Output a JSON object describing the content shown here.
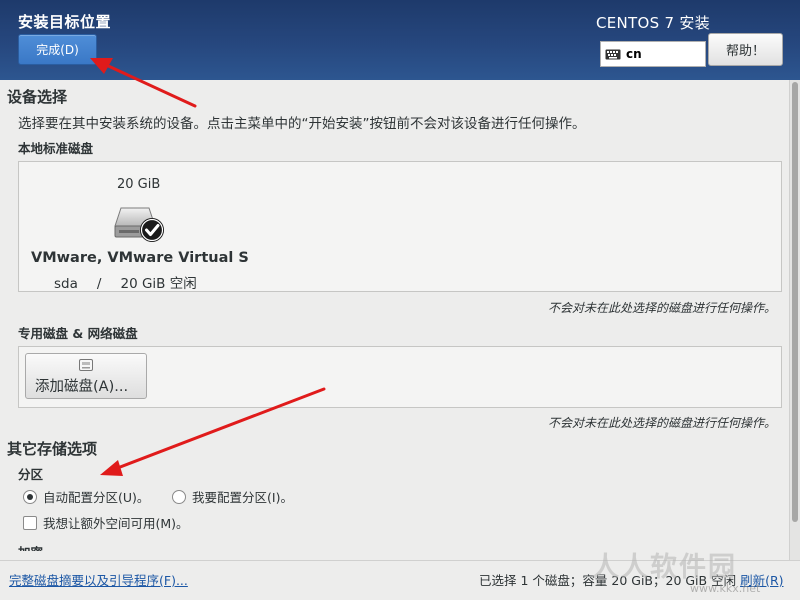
{
  "header": {
    "title": "安装目标位置",
    "done_label": "完成(D)",
    "product": "CENTOS 7 安装",
    "keyboard_layout": "cn",
    "help_label": "帮助！"
  },
  "device_selection": {
    "heading": "设备选择",
    "description": "选择要在其中安装系统的设备。点击主菜单中的“开始安装”按钮前不会对该设备进行任何操作。",
    "local_disks_heading": "本地标准磁盘",
    "disk": {
      "size": "20 GiB",
      "name": "VMware, VMware Virtual S",
      "device": "sda",
      "separator": "/",
      "free": "20 GiB 空闲",
      "icon": "harddisk-checked-icon"
    },
    "unselected_note": "不会对未在此处选择的磁盘进行任何操作。",
    "special_disks_heading": "专用磁盘 & 网络磁盘",
    "add_disk_label": "添加磁盘(A)...",
    "special_note": "不会对未在此处选择的磁盘进行任何操作。"
  },
  "other_storage": {
    "heading": "其它存储选项",
    "partitioning_heading": "分区",
    "auto_partition_label": "自动配置分区(U)。",
    "manual_partition_label": "我要配置分区(I)。",
    "auto_partition_selected": true,
    "extra_space_label": "我想让额外空间可用(M)。",
    "extra_space_checked": false,
    "encryption_heading": "加密"
  },
  "footer": {
    "summary_link": "完整磁盘摘要以及引导程序(F)...",
    "status": "已选择 1 个磁盘；容量 20 GiB；20 GiB 空闲",
    "refresh_link": "刷新(R)"
  },
  "watermark": {
    "text": "人人软件园",
    "url": "www.kkx.net"
  },
  "colors": {
    "header_bg": "#26477e",
    "done_button": "#3a78c6",
    "link": "#1c57a5",
    "annotation_arrow": "#e01b1b"
  }
}
